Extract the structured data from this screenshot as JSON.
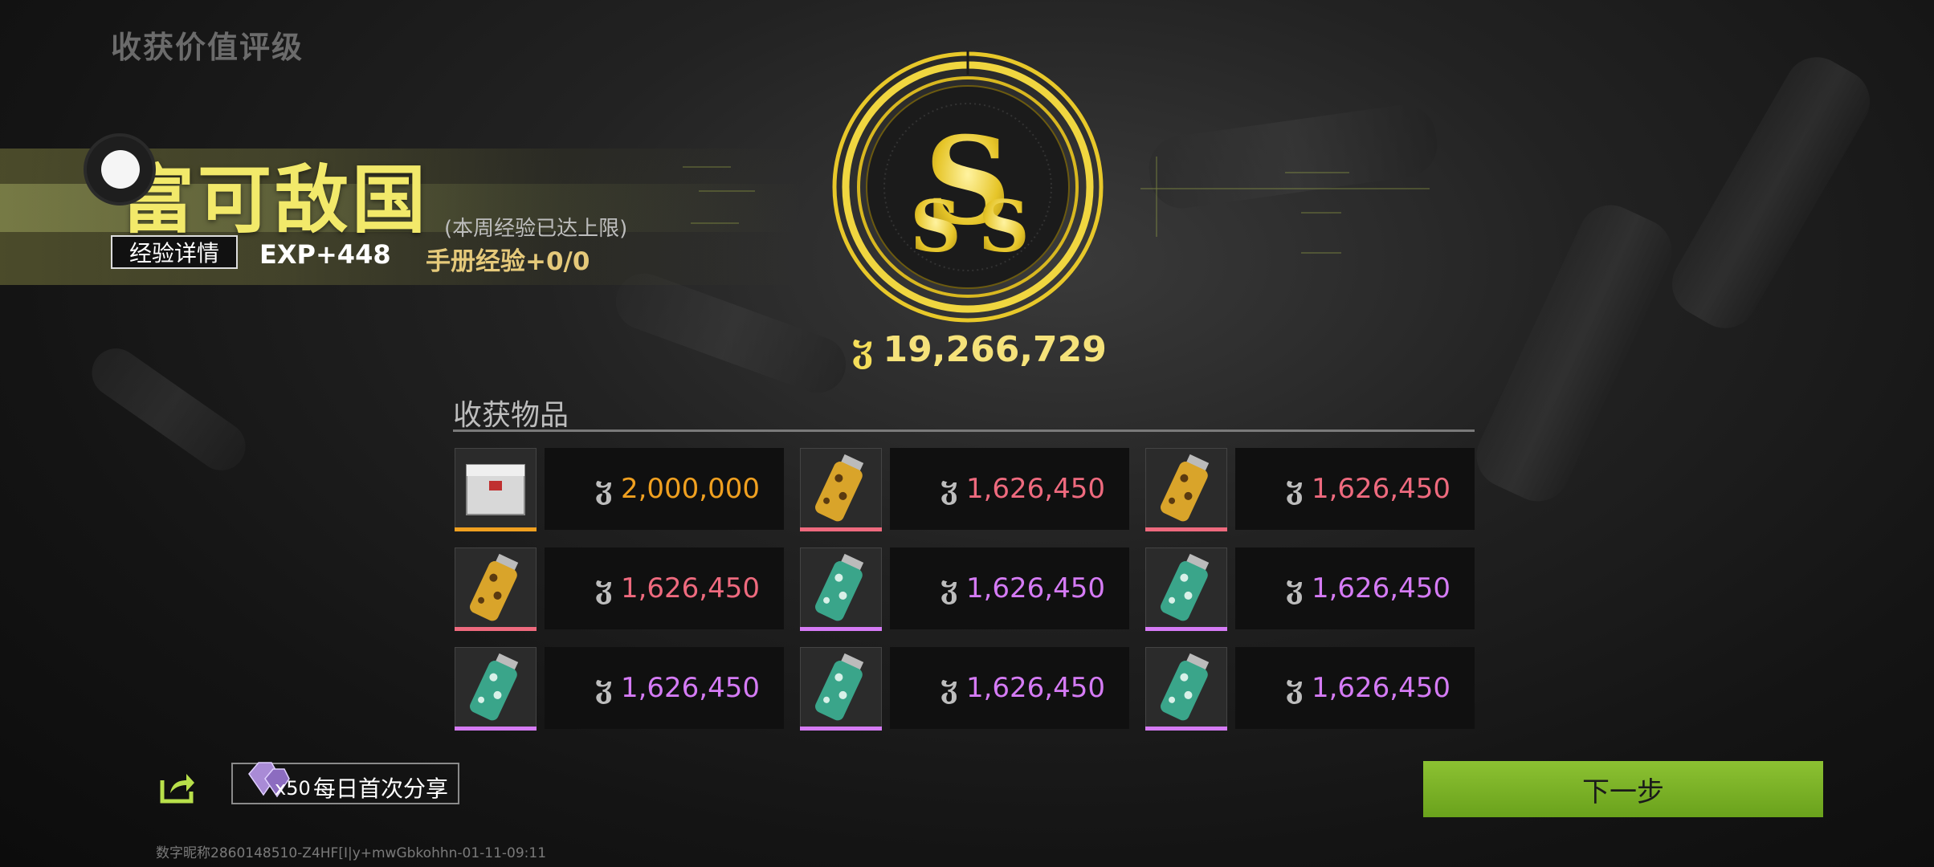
{
  "header": {
    "page_title": "收获价值评级"
  },
  "rating": {
    "title": "富可敌国",
    "exp_detail_button": "经验详情",
    "exp_gain": "EXP+448",
    "weekly_cap_note": "(本周经验已达上限)",
    "manual_exp": "手册经验+0/0",
    "medal_letters": "SSS",
    "total_value": "19,266,729"
  },
  "items_section": {
    "title": "收获物品",
    "items": [
      {
        "icon": "crate-icon",
        "value": "2,000,000",
        "rarity": "orange"
      },
      {
        "icon": "spray-can-gold-icon",
        "value": "1,626,450",
        "rarity": "pink"
      },
      {
        "icon": "spray-can-gold-icon",
        "value": "1,626,450",
        "rarity": "pink"
      },
      {
        "icon": "spray-can-gold-icon",
        "value": "1,626,450",
        "rarity": "pink"
      },
      {
        "icon": "spray-can-teal-icon",
        "value": "1,626,450",
        "rarity": "purple"
      },
      {
        "icon": "spray-can-teal-icon",
        "value": "1,626,450",
        "rarity": "purple"
      },
      {
        "icon": "spray-can-teal-icon",
        "value": "1,626,450",
        "rarity": "purple"
      },
      {
        "icon": "spray-can-teal-icon",
        "value": "1,626,450",
        "rarity": "purple"
      },
      {
        "icon": "spray-can-teal-icon",
        "value": "1,626,450",
        "rarity": "purple"
      }
    ]
  },
  "share": {
    "gem_count": "x50",
    "label": "每日首次分享"
  },
  "next_button": "下一步",
  "footer_id": "数字昵称2860148510-Z4HF[I|y+mwGbkohhn-01-11-09:11",
  "colors": {
    "orange": "#f0a020",
    "pink": "#ee6a7e",
    "purple": "#d57bf5",
    "accent_green": "#7bb327",
    "gold": "#f5de5a"
  }
}
